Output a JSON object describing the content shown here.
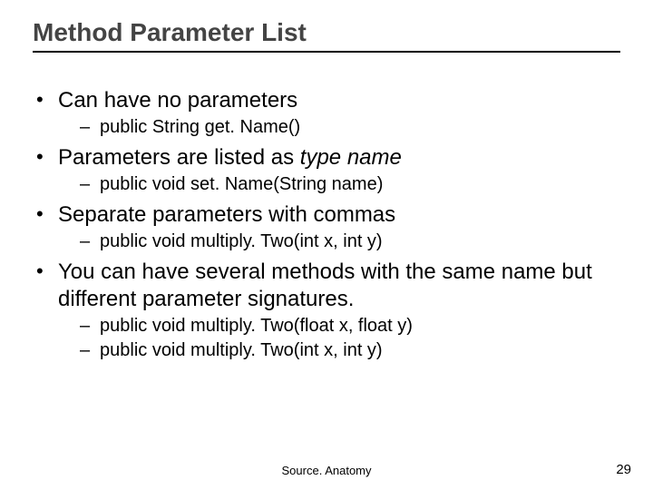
{
  "title": "Method Parameter List",
  "bullets": {
    "b1": {
      "text": "Can have no parameters",
      "sub": [
        "public String get. Name()"
      ]
    },
    "b2": {
      "prefix": "Parameters are listed as ",
      "italic": "type name",
      "sub": [
        "public void set. Name(String name)"
      ]
    },
    "b3": {
      "text": "Separate parameters with commas",
      "sub": [
        "public void multiply. Two(int x, int y)"
      ]
    },
    "b4": {
      "text": "You can have several methods with the same name but different parameter signatures.",
      "sub": [
        "public void multiply. Two(float x, float y)",
        "public void multiply. Two(int x, int y)"
      ]
    }
  },
  "footer": {
    "center": "Source. Anatomy",
    "page": "29"
  }
}
